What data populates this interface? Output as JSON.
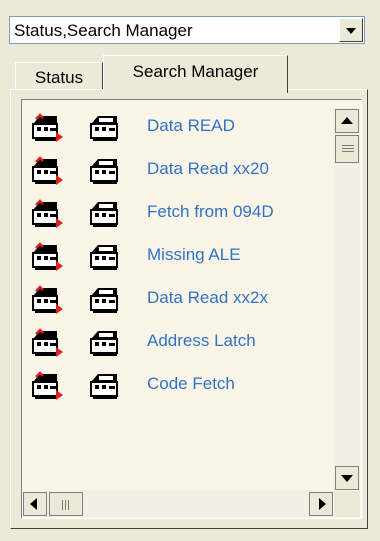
{
  "view_selector": {
    "value": "Status,Search Manager",
    "dropdown_icon": "chevron-down-icon"
  },
  "tabs": [
    {
      "label": "Status",
      "selected": false
    },
    {
      "label": "Search Manager",
      "selected": true
    }
  ],
  "search_list": {
    "items": [
      {
        "label": "Data READ",
        "icon_a": "search-run-icon",
        "icon_b": "search-edit-icon"
      },
      {
        "label": "Data Read xx20",
        "icon_a": "search-run-icon",
        "icon_b": "search-edit-icon"
      },
      {
        "label": "Fetch from 094D",
        "icon_a": "search-run-icon",
        "icon_b": "search-edit-icon"
      },
      {
        "label": "Missing ALE",
        "icon_a": "search-run-icon",
        "icon_b": "search-edit-icon"
      },
      {
        "label": "Data Read xx2x",
        "icon_a": "search-run-icon",
        "icon_b": "search-edit-icon"
      },
      {
        "label": "Address Latch",
        "icon_a": "search-run-icon",
        "icon_b": "search-edit-icon"
      },
      {
        "label": "Code Fetch",
        "icon_a": "search-run-icon",
        "icon_b": "search-edit-icon"
      }
    ],
    "label_color": "#2F73C9",
    "background_color": "#FAF5E6"
  },
  "colors": {
    "window_bg": "#ECE9D8"
  }
}
